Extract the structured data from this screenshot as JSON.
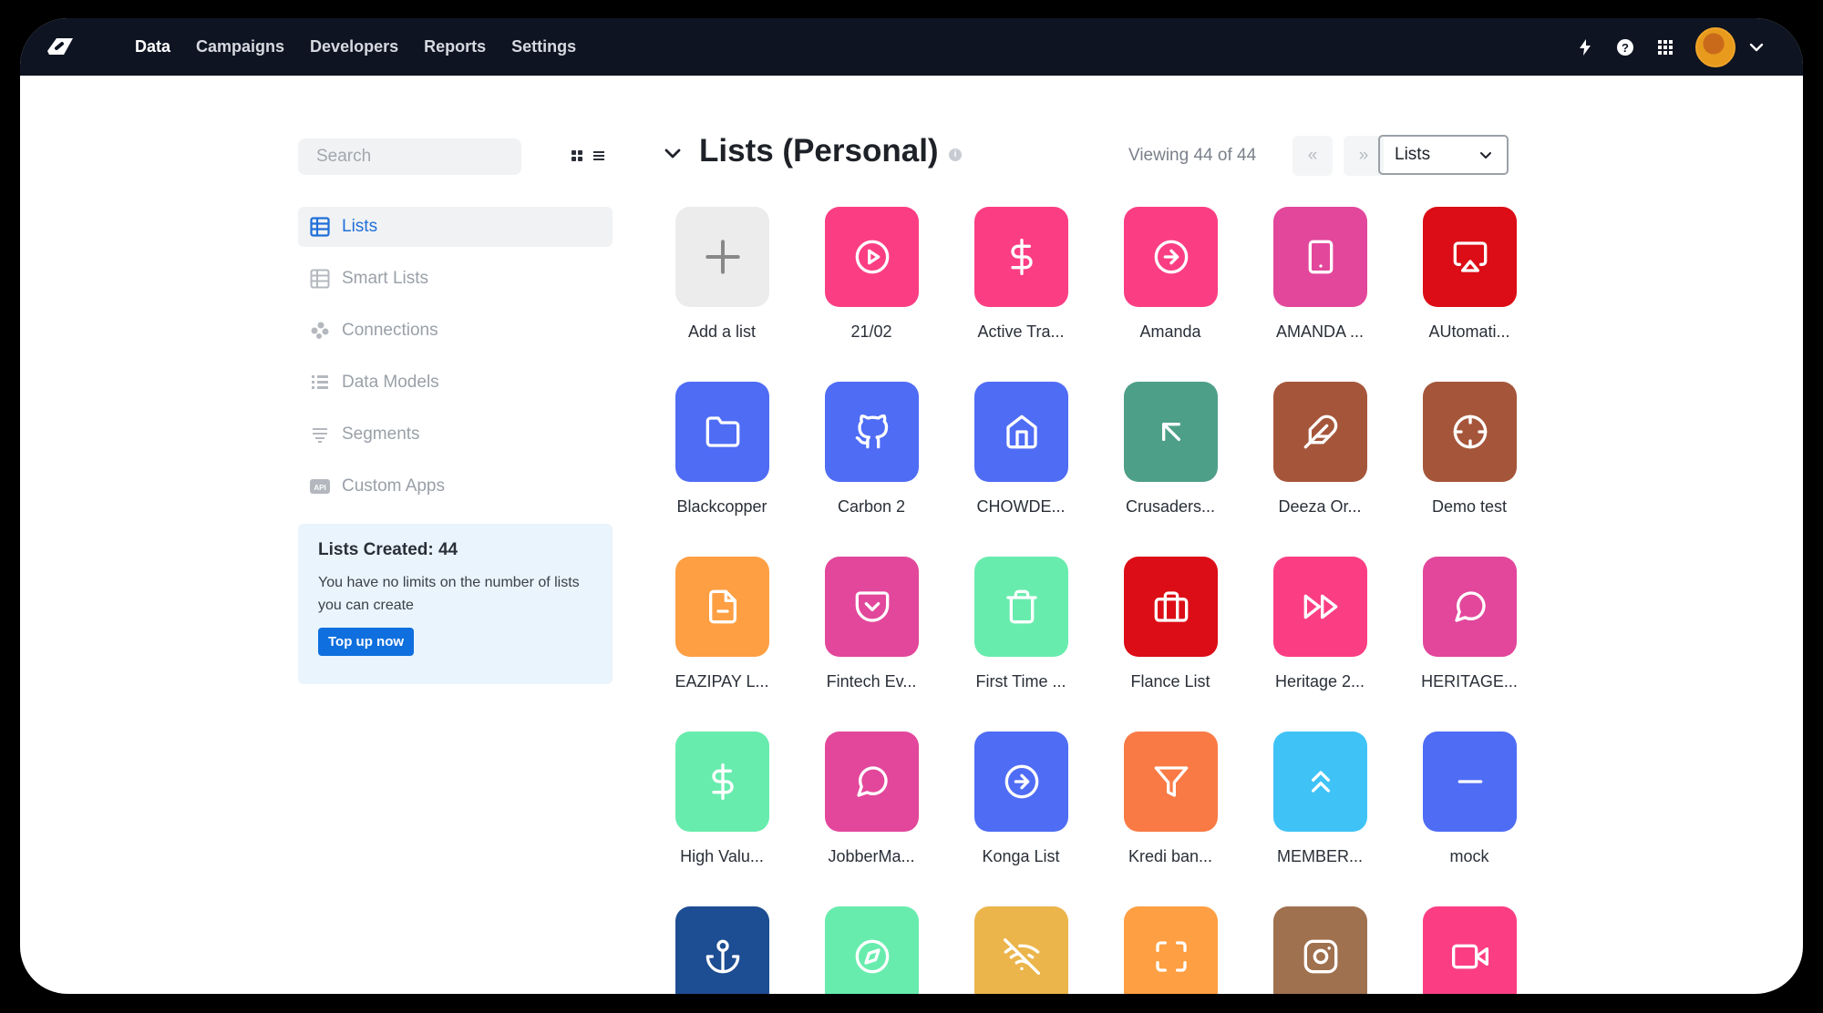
{
  "nav": {
    "items": [
      {
        "label": "Data",
        "active": true
      },
      {
        "label": "Campaigns",
        "active": false
      },
      {
        "label": "Developers",
        "active": false
      },
      {
        "label": "Reports",
        "active": false
      },
      {
        "label": "Settings",
        "active": false
      }
    ]
  },
  "topbar_icons": [
    "bolt-icon",
    "help-icon",
    "apps-grid-icon",
    "avatar",
    "chevron-down-icon"
  ],
  "sidebar": {
    "search_placeholder": "Search",
    "items": [
      {
        "label": "Lists",
        "icon": "table-icon",
        "active": true
      },
      {
        "label": "Smart Lists",
        "icon": "table-icon",
        "active": false
      },
      {
        "label": "Connections",
        "icon": "connections-icon",
        "active": false
      },
      {
        "label": "Data Models",
        "icon": "data-models-icon",
        "active": false
      },
      {
        "label": "Segments",
        "icon": "segments-icon",
        "active": false
      },
      {
        "label": "Custom Apps",
        "icon": "api-icon",
        "active": false
      }
    ],
    "card": {
      "title": "Lists Created: 44",
      "text": "You have no limits on the number of lists you can create",
      "button": "Top up now"
    }
  },
  "header": {
    "title": "Lists (Personal)",
    "info": "i",
    "viewing": "Viewing 44 of 44",
    "prev": "«",
    "next": "»",
    "select_value": "Lists"
  },
  "colors": {
    "accent": "#0f6fde",
    "topbar": "#0e1422"
  },
  "lists": [
    {
      "label": "Add a list",
      "icon": "plus-icon",
      "color": "#ececec"
    },
    {
      "label": "21/02",
      "icon": "play-circle-icon",
      "color": "#fb3e83"
    },
    {
      "label": "Active Tra...",
      "icon": "dollar-icon",
      "color": "#fb3e83"
    },
    {
      "label": "Amanda",
      "icon": "arrow-right-circle-icon",
      "color": "#fb3e83"
    },
    {
      "label": "AMANDA ...",
      "icon": "tablet-icon",
      "color": "#e2479b"
    },
    {
      "label": "AUtomati...",
      "icon": "airplay-icon",
      "color": "#dc0d16"
    },
    {
      "label": "Blackcopper",
      "icon": "folder-icon",
      "color": "#4f6cf5"
    },
    {
      "label": "Carbon 2",
      "icon": "github-icon",
      "color": "#4f6cf5"
    },
    {
      "label": "CHOWDE...",
      "icon": "home-icon",
      "color": "#4f6cf5"
    },
    {
      "label": "Crusaders...",
      "icon": "arrow-up-left-icon",
      "color": "#4e9f88"
    },
    {
      "label": "Deeza Or...",
      "icon": "feather-icon",
      "color": "#a5563a"
    },
    {
      "label": "Demo test",
      "icon": "crosshair-icon",
      "color": "#a5563a"
    },
    {
      "label": "EAZIPAY L...",
      "icon": "file-minus-icon",
      "color": "#fe9f43"
    },
    {
      "label": "Fintech Ev...",
      "icon": "pocket-icon",
      "color": "#e2479b"
    },
    {
      "label": "First Time ...",
      "icon": "trash-icon",
      "color": "#68ecae"
    },
    {
      "label": "Flance List",
      "icon": "briefcase-icon",
      "color": "#dc0d16"
    },
    {
      "label": "Heritage 2...",
      "icon": "fast-forward-icon",
      "color": "#fb3e83"
    },
    {
      "label": "HERITAGE...",
      "icon": "message-circle-icon",
      "color": "#e2479b"
    },
    {
      "label": "High Valu...",
      "icon": "dollar-icon",
      "color": "#68ecae"
    },
    {
      "label": "JobberMa...",
      "icon": "message-circle-icon",
      "color": "#e2479b"
    },
    {
      "label": "Konga List",
      "icon": "arrow-right-circle-icon",
      "color": "#4f6cf5"
    },
    {
      "label": "Kredi ban...",
      "icon": "filter-icon",
      "color": "#f97a45"
    },
    {
      "label": "MEMBER...",
      "icon": "chevrons-up-icon",
      "color": "#3fc3f6"
    },
    {
      "label": "mock",
      "icon": "minus-icon",
      "color": "#4f6cf5"
    },
    {
      "label": "",
      "icon": "anchor-icon",
      "color": "#1d4d92"
    },
    {
      "label": "",
      "icon": "compass-icon",
      "color": "#68ecae"
    },
    {
      "label": "",
      "icon": "wifi-off-icon",
      "color": "#ebb54b"
    },
    {
      "label": "",
      "icon": "maximize-icon",
      "color": "#fe9f43"
    },
    {
      "label": "",
      "icon": "instagram-icon",
      "color": "#a0714f"
    },
    {
      "label": "",
      "icon": "video-icon",
      "color": "#fb3e83"
    }
  ]
}
